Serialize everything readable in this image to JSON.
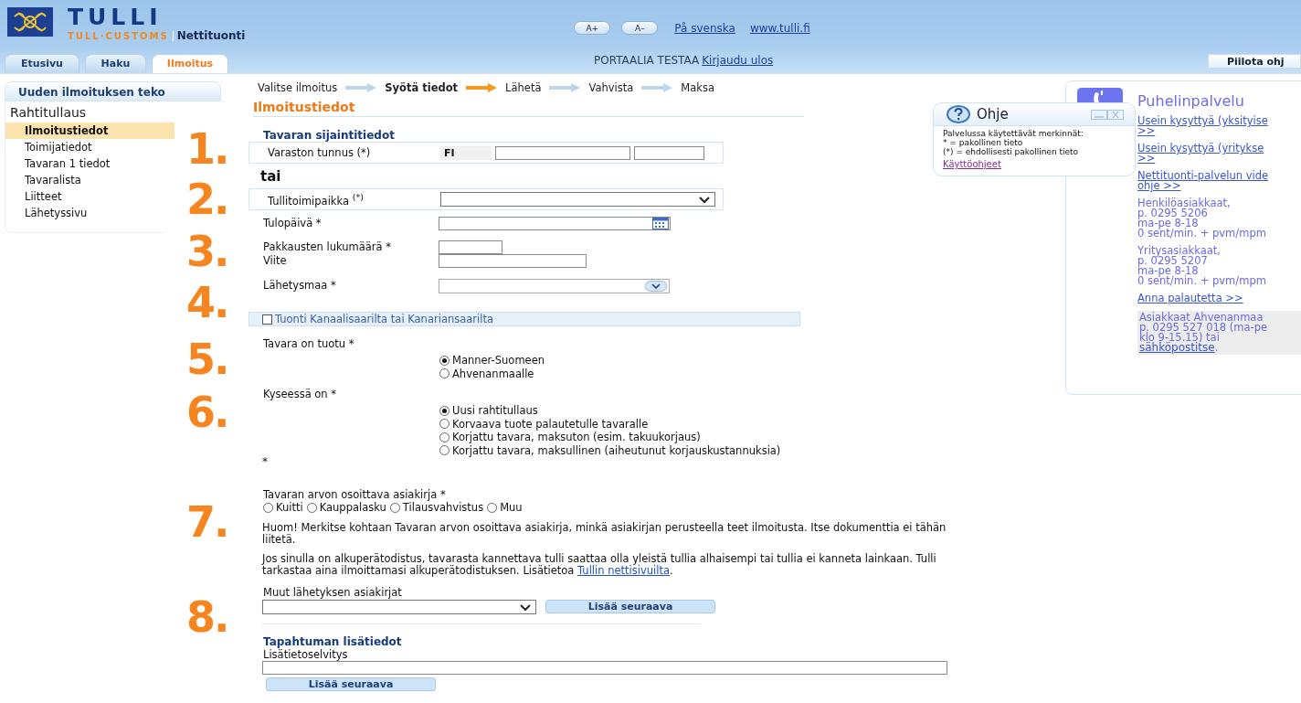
{
  "header": {
    "logo_title": "TULLI",
    "logo_subtitle": "TULL·CUSTOMS",
    "service": "Nettituonti",
    "font_buttons": [
      "A+",
      "A–"
    ],
    "links": [
      "På svenska",
      "www.tulli.fi"
    ]
  },
  "tabs": [
    {
      "label": "Etusivu",
      "selected": false
    },
    {
      "label": "Haku",
      "selected": false
    },
    {
      "label": "Ilmoitus",
      "selected": true
    }
  ],
  "user_bar": {
    "text": "PORTAALIA TESTAA",
    "logout": "Kirjaudu ulos",
    "hide_help": "Piilota ohj"
  },
  "sidebar": {
    "title": "Uuden ilmoituksen teko",
    "section": "Rahtitullaus",
    "items": [
      {
        "label": "Ilmoitustiedot",
        "selected": true
      },
      {
        "label": "Toimijatiedot",
        "selected": false
      },
      {
        "label": "Tavaran 1 tiedot",
        "selected": false
      },
      {
        "label": "Tavaralista",
        "selected": false
      },
      {
        "label": "Liitteet",
        "selected": false
      },
      {
        "label": "Lähetyssivu",
        "selected": false
      }
    ]
  },
  "steps": [
    {
      "label": "Valitse ilmoitus",
      "selected": false
    },
    {
      "label": "Syötä tiedot",
      "selected": true
    },
    {
      "label": "Lähetä",
      "selected": false
    },
    {
      "label": "Vahvista",
      "selected": false
    },
    {
      "label": "Maksa",
      "selected": false
    }
  ],
  "annotations": [
    "1.",
    "2.",
    "3.",
    "4.",
    "5.",
    "6.",
    "7.",
    "8."
  ],
  "form": {
    "title": "Ilmoitustiedot",
    "location": {
      "heading": "Tavaran sijaintitiedot",
      "label": "Varaston tunnus (*)",
      "prefix": "FI"
    },
    "or": "tai",
    "customs_office": {
      "label": "Tullitoimipaikka $^{(*)}$"
    },
    "arrival_date": {
      "label": "Tulopäivä *"
    },
    "package_count": {
      "label": "Pakkausten lukumäärä *"
    },
    "reference": {
      "label": "Viite"
    },
    "country": {
      "label": "Lähetysmaa *"
    },
    "channel_islands": {
      "label": "Tuonti Kanaalisaarilta tai Kanariansaarilta",
      "checked": false
    },
    "imported_to": {
      "label": "Tavara on tuotu *",
      "options": [
        {
          "label": "Manner-Suomeen",
          "selected": true
        },
        {
          "label": "Ahvenanmaalle",
          "selected": false
        }
      ]
    },
    "case": {
      "label": "Kyseessä on *",
      "options": [
        {
          "label": "Uusi rahtitullaus",
          "selected": true
        },
        {
          "label": "Korvaava tuote palautetulle tavaralle",
          "selected": false
        },
        {
          "label": "Korjattu tavara, maksuton (esim. takuukorjaus)",
          "selected": false
        },
        {
          "label": "Korjattu tavara, maksullinen (aiheutunut korjauskustannuksia)",
          "selected": false
        }
      ]
    },
    "note_mark": "*",
    "value_document": {
      "label": "Tavaran arvon osoittava asiakirja *",
      "options": [
        {
          "label": "Kuitti",
          "selected": false
        },
        {
          "label": "Kauppalasku",
          "selected": false
        },
        {
          "label": "Tilausvahvistus",
          "selected": false
        },
        {
          "label": "Muu",
          "selected": false
        }
      ]
    },
    "notice": "Huom! Merkitse kohtaan Tavaran arvon osoittava asiakirja, minkä asiakirjan perusteella teet ilmoitusta. Itse dokumenttia ei tähän liitetä.",
    "origin_info": {
      "text": "Jos sinulla on alkuperätodistus, tavarasta kannettava tulli saattaa olla yleistä tullia alhaisempi tai tullia ei kanneta lainkaan. Tulli tarkastaa aina ilmoittamasi alkuperätodistuksen. Lisätietoa ",
      "link": "Tullin nettisivuilta",
      "after": "."
    },
    "other_documents": {
      "label": "Muut lähetyksen asiakirjat",
      "button": "Lisää seuraava"
    },
    "additional": {
      "heading": "Tapahtuman lisätiedot",
      "label": "Lisätietoselvitys",
      "button": "Lisää seuraava"
    }
  },
  "help_popup": {
    "title": "Ohje",
    "lines": [
      "Palvelussa käytettävät merkinnät:",
      "* = pakollinen tieto",
      "(*) = ehdollisesti pakollinen tieto"
    ],
    "link": "Käyttöohjeet"
  },
  "phone_panel": {
    "title": "Puhelinpalvelu",
    "links": [
      [
        "Usein kysyttyä (yksityise",
        ">>"
      ],
      [
        "Usein kysyttyä (yritykse",
        ">>"
      ],
      [
        "Nettituonti-palvelun vide",
        "ohje >>"
      ]
    ],
    "contacts": [
      [
        "Henkilöasiakkaat,",
        "p. 0295 5206",
        "ma-pe 8-18",
        "0 sent/min. + pvm/mpm"
      ],
      [
        "Yritysasiakkaat,",
        "p. 0295 5207",
        "ma-pe 8-18",
        "0 sent/min. + pvm/mpm"
      ]
    ],
    "feedback": "Anna palautetta >>",
    "aland": {
      "lines": [
        "Asiakkaat Ahvenanmaa",
        "p. 0295 527 018 (ma-pe",
        "klo 9-15.15) tai"
      ],
      "link": "sähköpostitse",
      "after": "."
    }
  }
}
